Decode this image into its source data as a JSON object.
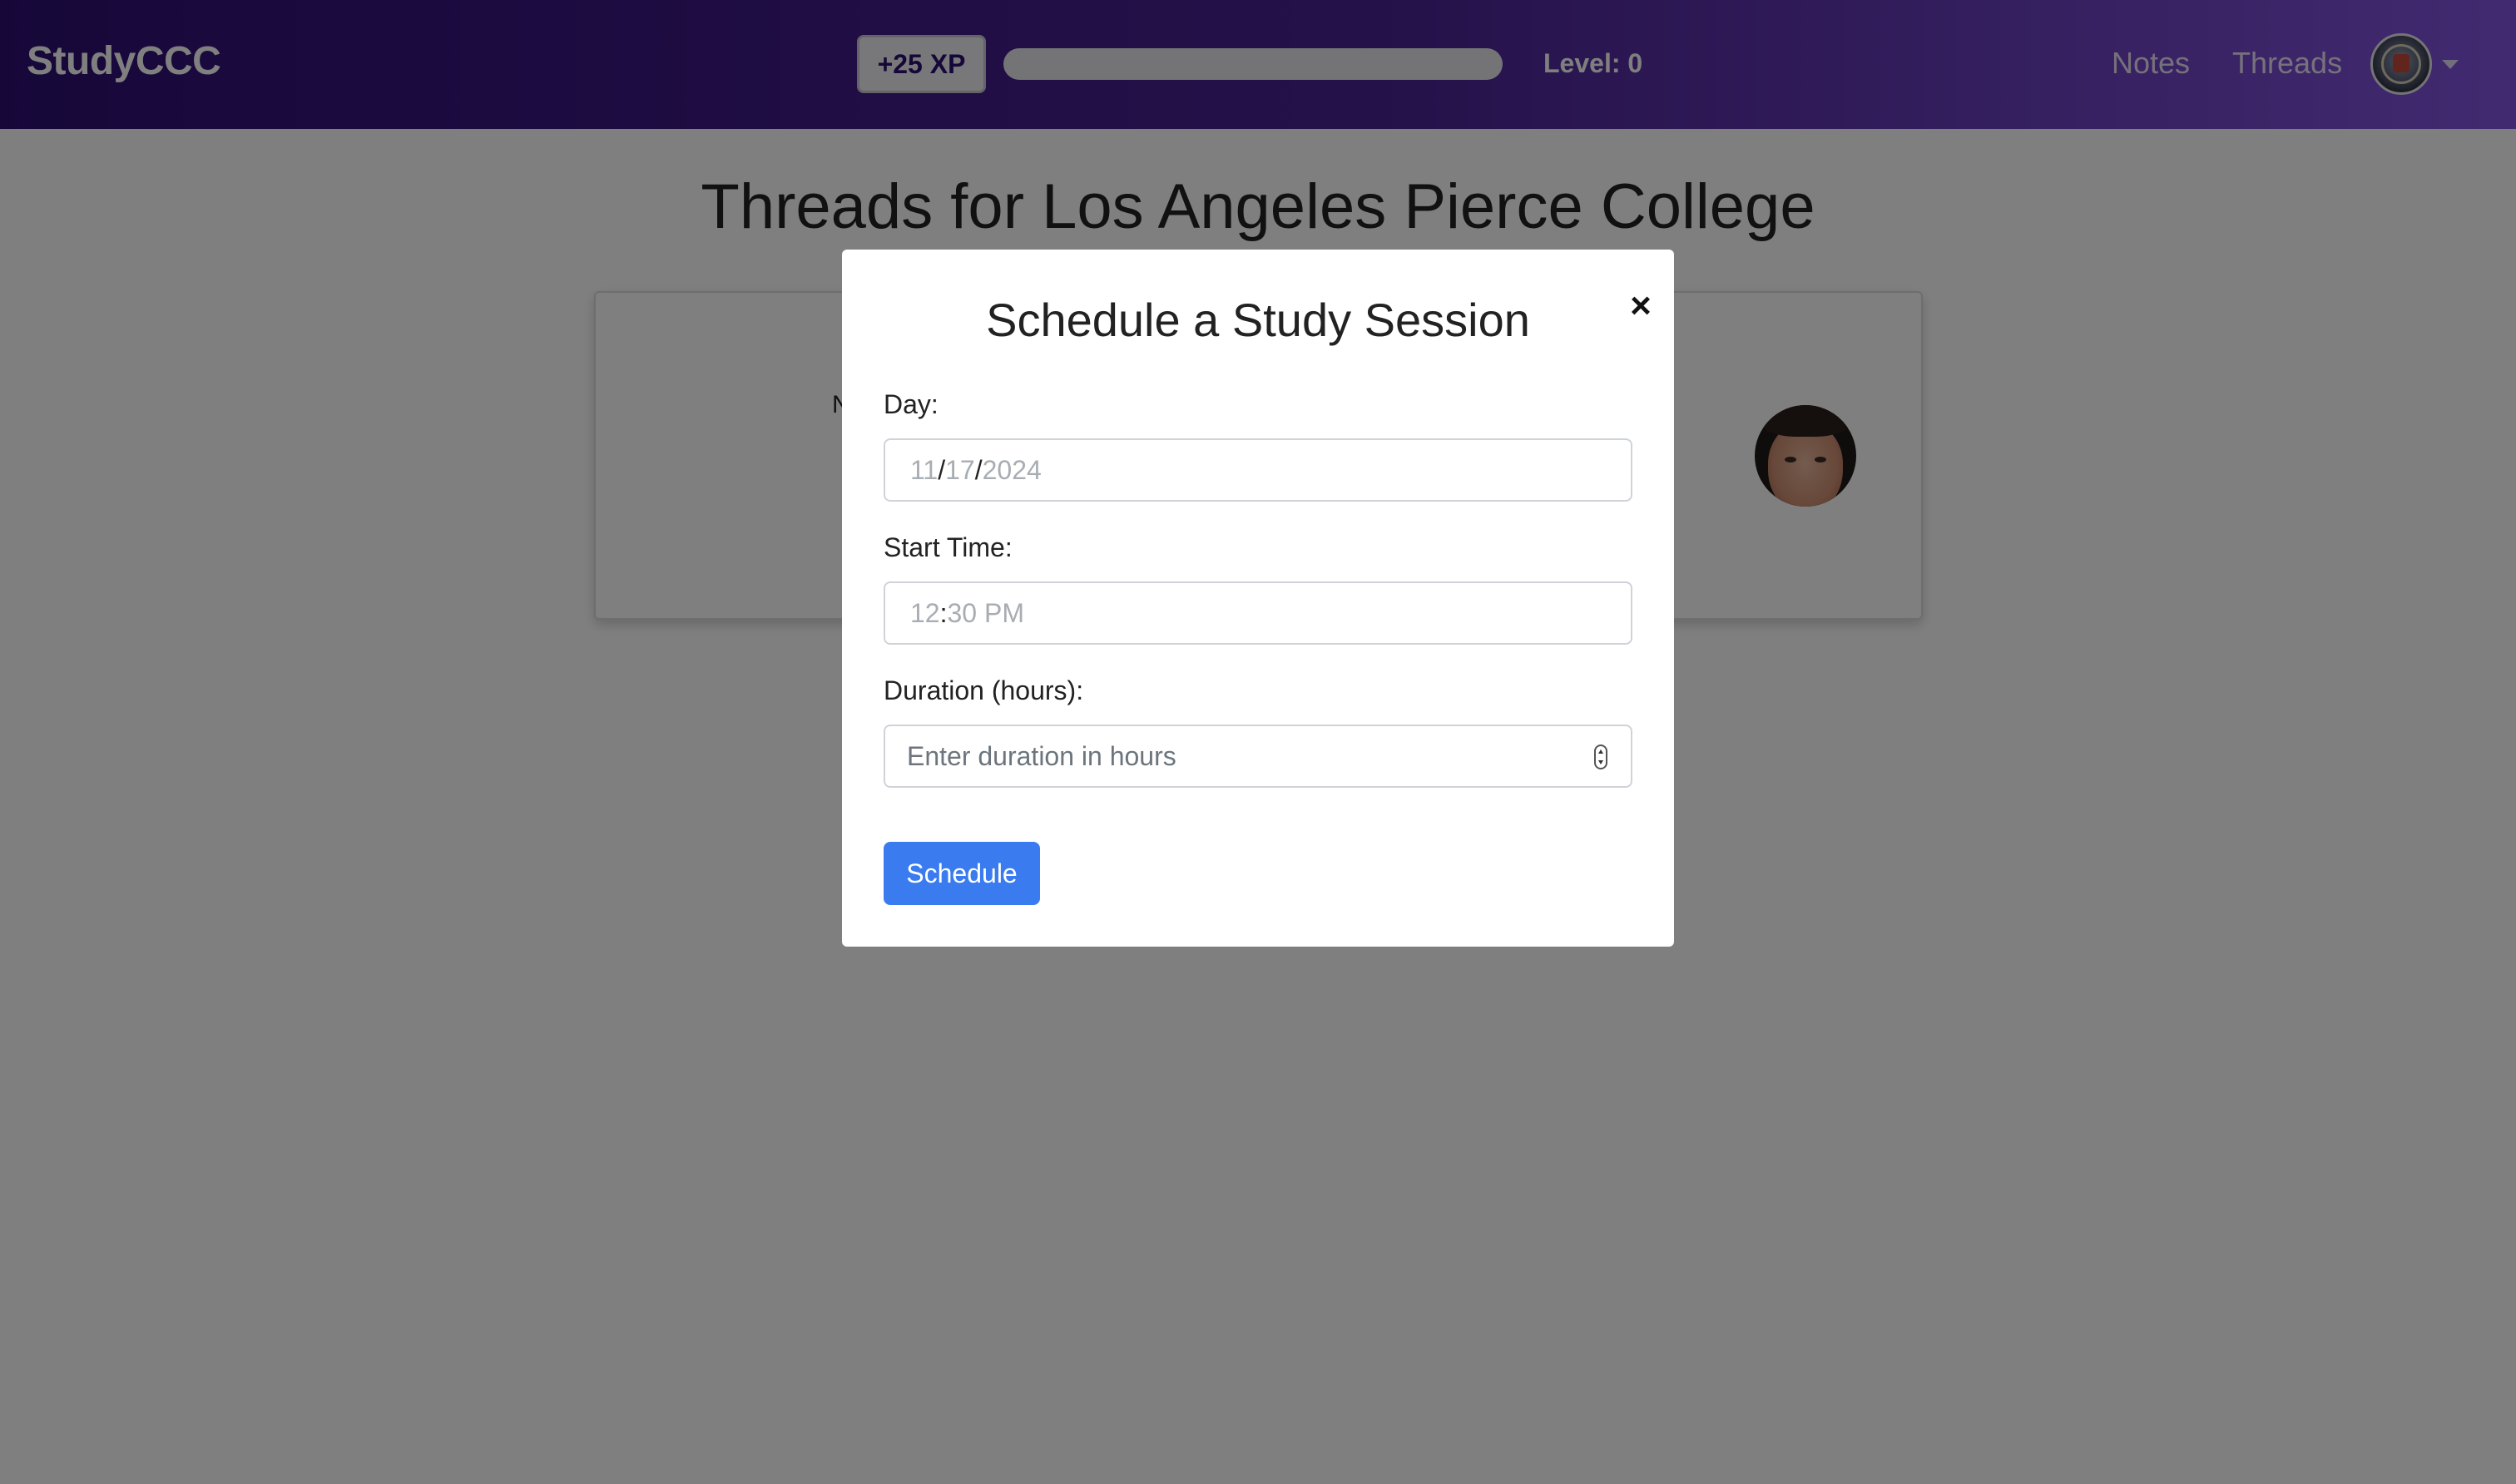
{
  "navbar": {
    "brand": "StudyCCC",
    "xp_badge": "+25 XP",
    "xp_progress": 0,
    "level_label": "Level: 0",
    "links": [
      "Notes",
      "Threads"
    ]
  },
  "page": {
    "title": "Threads for Los Angeles Pierce College",
    "card": {
      "left_fragment": "N",
      "right_fragment": "'"
    }
  },
  "modal": {
    "title": "Schedule a Study Session",
    "close_symbol": "×",
    "day": {
      "label": "Day:",
      "month": "11",
      "sep1": "/",
      "day": "17",
      "sep2": "/",
      "year": "2024"
    },
    "start_time": {
      "label": "Start Time:",
      "hour": "12",
      "sep": ":",
      "minute": "30",
      "ampm": "PM"
    },
    "duration": {
      "label": "Duration (hours):",
      "placeholder": "Enter duration in hours"
    },
    "submit_label": "Schedule"
  }
}
